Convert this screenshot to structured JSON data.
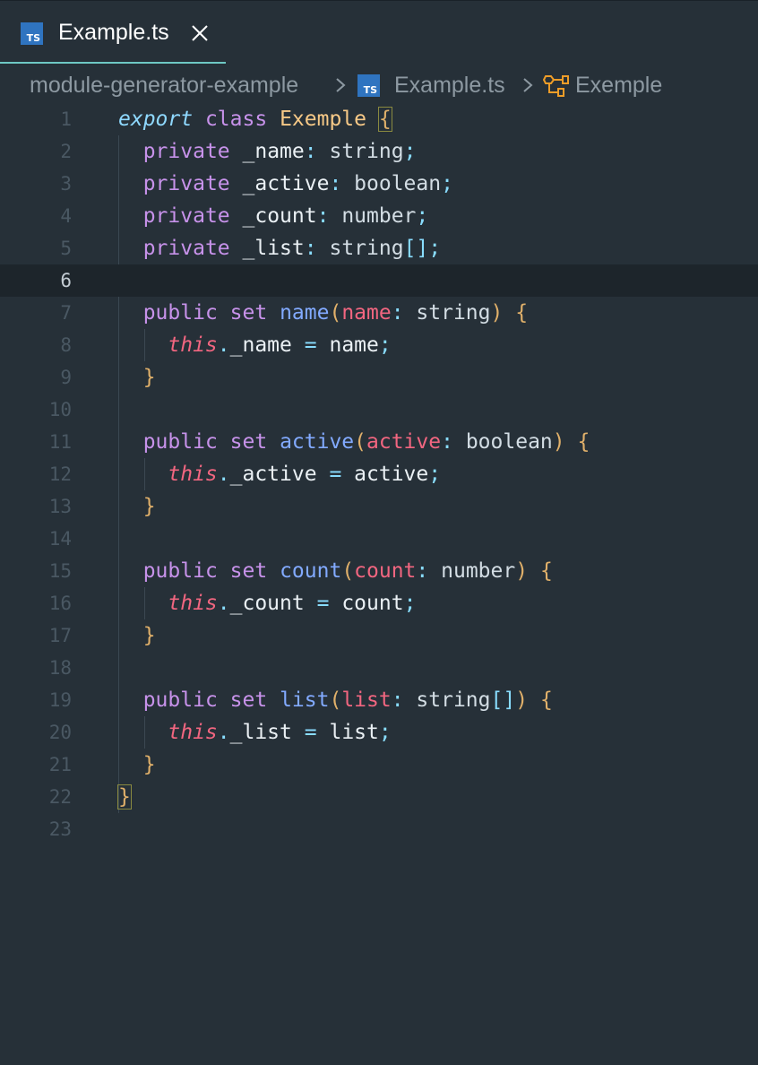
{
  "tab": {
    "icon": "typescript-file-icon",
    "icon_text": "TS",
    "label": "Example.ts",
    "close_icon": "close-icon"
  },
  "breadcrumb": {
    "folder": "module-generator-example",
    "file_icon_text": "TS",
    "file": "Example.ts",
    "symbol_icon": "class-symbol-icon",
    "symbol": "Exemple"
  },
  "editor": {
    "current_line": 6,
    "lines": [
      {
        "n": "1"
      },
      {
        "n": "2"
      },
      {
        "n": "3"
      },
      {
        "n": "4"
      },
      {
        "n": "5"
      },
      {
        "n": "6"
      },
      {
        "n": "7"
      },
      {
        "n": "8"
      },
      {
        "n": "9"
      },
      {
        "n": "10"
      },
      {
        "n": "11"
      },
      {
        "n": "12"
      },
      {
        "n": "13"
      },
      {
        "n": "14"
      },
      {
        "n": "15"
      },
      {
        "n": "16"
      },
      {
        "n": "17"
      },
      {
        "n": "18"
      },
      {
        "n": "19"
      },
      {
        "n": "20"
      },
      {
        "n": "21"
      },
      {
        "n": "22"
      },
      {
        "n": "23"
      }
    ],
    "tokens": {
      "export": "export",
      "class": "class",
      "class_name": "Exemple",
      "open_brace": "{",
      "close_brace": "}",
      "private": "private",
      "public": "public",
      "set": "set",
      "this": "this",
      "f_name": "_name",
      "f_active": "_active",
      "f_count": "_count",
      "f_list": "_list",
      "t_string": "string",
      "t_boolean": "boolean",
      "t_number": "number",
      "arr": "[]",
      "colon": ":",
      "semi": ";",
      "dot": ".",
      "eq": "=",
      "lparen": "(",
      "rparen": ")",
      "p_name": "name",
      "p_active": "active",
      "p_count": "count",
      "p_list": "list"
    }
  },
  "colors": {
    "background": "#263038",
    "tab_accent": "#6ec8c4",
    "keyword": "#c792ea",
    "keyword_italic": "#8fd9ff",
    "class_name": "#f7c987",
    "function": "#82aaff",
    "parameter": "#f26680",
    "punctuation": "#89ddff",
    "typescript_blue": "#2f74c0"
  }
}
